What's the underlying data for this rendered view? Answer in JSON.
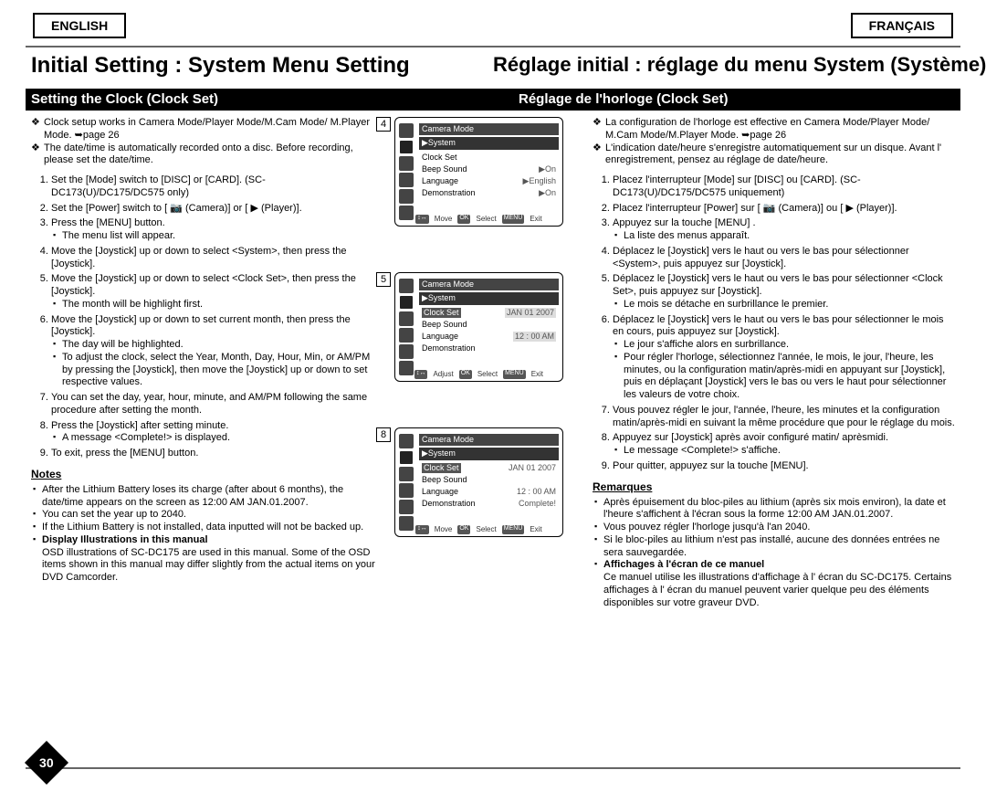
{
  "lang_en": "ENGLISH",
  "lang_fr": "FRANÇAIS",
  "title_en": "Initial Setting : System Menu Setting",
  "title_fr": "Réglage initial : réglage du menu System (Système)",
  "sub_en": "Setting the Clock (Clock Set)",
  "sub_fr": "Réglage de l'horloge (Clock Set)",
  "page_number": "30",
  "en": {
    "diam1": "Clock setup works in Camera Mode/Player Mode/M.Cam Mode/ M.Player Mode. ➥page 26",
    "diam2": "The date/time is automatically recorded onto a disc. Before recording, please set the date/time.",
    "s1": "Set the [Mode] switch to [DISC] or [CARD]. (SC-DC173(U)/DC175/DC575 only)",
    "s2": "Set the [Power] switch to [ 📷 (Camera)] or [ ▶ (Player)].",
    "s3": "Press the [MENU] button.",
    "s3b": "The menu list will appear.",
    "s4": "Move the [Joystick] up or down to select <System>, then press the [Joystick].",
    "s5": "Move the [Joystick] up or down to select <Clock Set>, then press the [Joystick].",
    "s5b": "The month will be highlight first.",
    "s6": "Move the [Joystick] up or down to set current month, then press the [Joystick].",
    "s6b1": "The day will be highlighted.",
    "s6b2": "To adjust the clock, select the Year, Month, Day, Hour, Min, or AM/PM by pressing the [Joystick], then move the [Joystick] up or down to set respective values.",
    "s7": "You can set the day, year, hour, minute, and AM/PM following the same procedure after setting the month.",
    "s8": "Press the [Joystick] after setting minute.",
    "s8b": "A message <Complete!> is displayed.",
    "s9": "To exit, press the [MENU] button.",
    "notes_title": "Notes",
    "n1": "After the Lithium Battery loses its charge (after about 6 months), the date/time appears on the screen as 12:00 AM JAN.01.2007.",
    "n2": "You can set the year up to 2040.",
    "n3": "If the Lithium Battery is not installed, data inputted will not be backed up.",
    "n4t": "Display Illustrations in this manual",
    "n4": "OSD illustrations of SC-DC175 are used in this manual. Some of the OSD items shown in this manual may differ slightly from the actual items on your DVD Camcorder."
  },
  "fr": {
    "diam1": "La configuration de l'horloge est effective en Camera Mode/Player Mode/ M.Cam Mode/M.Player Mode. ➥page 26",
    "diam2": "L'indication date/heure s'enregistre automatiquement sur un disque. Avant l' enregistrement, pensez au réglage de date/heure.",
    "s1": "Placez l'interrupteur [Mode] sur [DISC] ou [CARD]. (SC-DC173(U)/DC175/DC575 uniquement)",
    "s2": "Placez l'interrupteur [Power] sur [ 📷 (Camera)] ou [ ▶ (Player)].",
    "s3": "Appuyez sur la touche [MENU] .",
    "s3b": "La liste des menus apparaît.",
    "s4": "Déplacez le [Joystick] vers le haut ou vers le bas pour sélectionner <System>, puis appuyez sur [Joystick].",
    "s5": "Déplacez le [Joystick] vers le haut ou vers le bas pour sélectionner <Clock Set>, puis appuyez sur [Joystick].",
    "s5b": "Le mois se détache en surbrillance le premier.",
    "s6": "Déplacez le [Joystick] vers le haut ou vers le bas pour sélectionner le mois en cours, puis appuyez sur [Joystick].",
    "s6b1": "Le jour s'affiche alors en surbrillance.",
    "s6b2": "Pour régler l'horloge, sélectionnez l'année, le mois, le jour, l'heure, les minutes, ou la configuration matin/après-midi en appuyant sur [Joystick], puis en déplaçant [Joystick] vers le bas ou vers le haut pour sélectionner les valeurs de votre choix.",
    "s7": "Vous pouvez régler le jour, l'année, l'heure, les minutes et la configuration matin/après-midi en suivant la même procédure que pour le réglage du mois.",
    "s8": "Appuyez sur [Joystick] après avoir configuré matin/ aprèsmidi.",
    "s8b": "Le message <Complete!> s'affiche.",
    "s9": "Pour quitter, appuyez sur la touche [MENU].",
    "notes_title": "Remarques",
    "n1": "Après épuisement du bloc-piles au lithium (après six mois environ), la date et l'heure s'affichent à l'écran sous la forme 12:00 AM JAN.01.2007.",
    "n2": "Vous pouvez régler l'horloge jusqu'à l'an 2040.",
    "n3": "Si le bloc-piles au lithium n'est pas installé, aucune des données entrées ne sera sauvegardée.",
    "n4t": "Affichages à l'écran de ce manuel",
    "n4": "Ce manuel utilise les illustrations d'affichage à l' écran du SC-DC175. Certains affichages à l' écran du manuel peuvent varier quelque peu des éléments disponibles sur votre graveur DVD."
  },
  "figs": {
    "num4": "4",
    "num5": "5",
    "num8": "8",
    "camera_mode": "Camera Mode",
    "system": "▶System",
    "clock_set": "Clock Set",
    "beep": "Beep Sound",
    "lang": "Language",
    "demo": "Demonstration",
    "on": "▶On",
    "english": "▶English",
    "date1": "JAN  01  2007",
    "time1": "12 : 00  AM",
    "complete": "Complete!",
    "move": "Move",
    "adjust": "Adjust",
    "select": "Select",
    "exit": "Exit",
    "ok": "OK",
    "menu": "MENU",
    "arrows": "↕↔"
  }
}
